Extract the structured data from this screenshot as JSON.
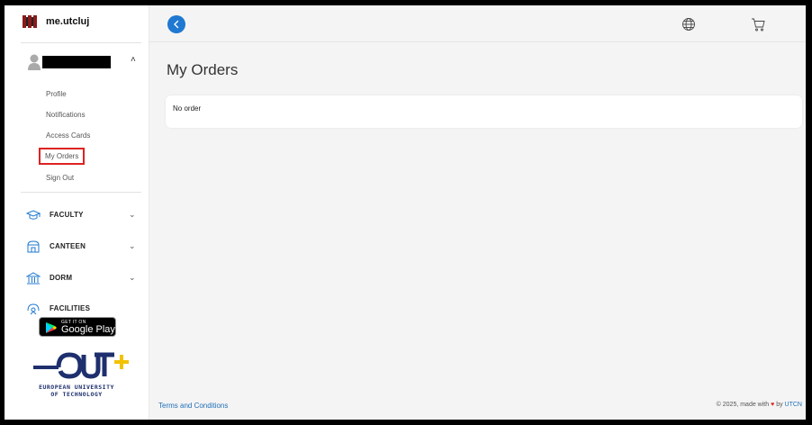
{
  "brand": {
    "name": "me.utcluj"
  },
  "user": {
    "name_redacted": true
  },
  "profile_menu": [
    {
      "label": "Profile"
    },
    {
      "label": "Notifications"
    },
    {
      "label": "Access Cards"
    },
    {
      "label": "My Orders",
      "active": true
    },
    {
      "label": "Sign Out"
    }
  ],
  "nav": [
    {
      "label": "FACULTY",
      "icon": "graduation-cap-icon",
      "expandable": true
    },
    {
      "label": "CANTEEN",
      "icon": "canteen-icon",
      "expandable": true
    },
    {
      "label": "DORM",
      "icon": "building-icon",
      "expandable": true
    },
    {
      "label": "FACILITIES",
      "icon": "facilities-icon",
      "expandable": false
    }
  ],
  "store_badge": {
    "small": "GET IT ON",
    "big": "Google Play"
  },
  "eut": {
    "line1": "EUROPEAN UNIVERSITY",
    "line2": "OF TECHNOLOGY"
  },
  "page": {
    "title": "My Orders",
    "empty_text": "No order"
  },
  "footer": {
    "terms": "Terms and Conditions",
    "copyright_prefix": "© 2025, made with",
    "by": "by",
    "org": "UTCN"
  },
  "colors": {
    "accent": "#1f78d1",
    "active_outline": "#d22222",
    "heart": "#e02424",
    "eut_yellow": "#f2c200",
    "eut_blue": "#1e2f6e"
  }
}
